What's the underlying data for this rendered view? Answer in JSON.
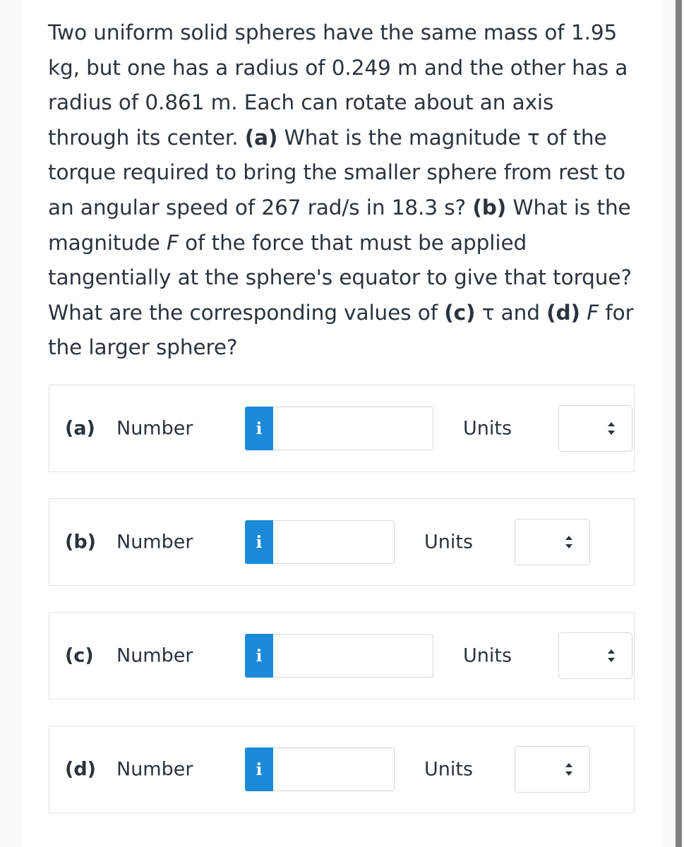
{
  "problem": {
    "segments": [
      {
        "text": "Two uniform solid spheres have the same mass of 1.95 kg, but one has a radius of 0.249 m and the other has a radius of 0.861 m. Each can rotate about an axis through its center. ",
        "style": "normal"
      },
      {
        "text": "(a)",
        "style": "bold"
      },
      {
        "text": " What is the magnitude ",
        "style": "normal"
      },
      {
        "text": "τ",
        "style": "symbol"
      },
      {
        "text": " of the torque required to bring the smaller sphere from rest to an angular speed of 267 rad/s in 18.3 s? ",
        "style": "normal"
      },
      {
        "text": "(b)",
        "style": "bold"
      },
      {
        "text": " What is the magnitude ",
        "style": "normal"
      },
      {
        "text": "F",
        "style": "italic"
      },
      {
        "text": " of the force that must be applied tangentially at the sphere's equator to give that torque? What are the corresponding values of ",
        "style": "normal"
      },
      {
        "text": "(c)",
        "style": "bold"
      },
      {
        "text": " ",
        "style": "normal"
      },
      {
        "text": "τ",
        "style": "symbol"
      },
      {
        "text": " and ",
        "style": "normal"
      },
      {
        "text": "(d)",
        "style": "bold"
      },
      {
        "text": " ",
        "style": "normal"
      },
      {
        "text": "F",
        "style": "italic"
      },
      {
        "text": " for the larger sphere?",
        "style": "normal"
      }
    ],
    "full_text": "Two uniform solid spheres have the same mass of 1.95 kg, but one has a radius of 0.249 m and the other has a radius of 0.861 m. Each can rotate about an axis through its center. (a) What is the magnitude τ of the torque required to bring the smaller sphere from rest to an angular speed of 267 rad/s in 18.3 s? (b) What is the magnitude F of the force that must be applied tangentially at the sphere's equator to give that torque? What are the corresponding values of (c) τ and (d) F for the larger sphere?",
    "values": {
      "mass": "1.95 kg",
      "radius_small": "0.249 m",
      "radius_large": "0.861 m",
      "angular_speed": "267 rad/s",
      "time": "18.3 s"
    }
  },
  "answers": {
    "rows": [
      {
        "part": "(a)",
        "number_label": "Number",
        "info_icon": "info-icon",
        "info_glyph": "i",
        "number_value": "",
        "number_placeholder": "",
        "units_label": "Units",
        "units_value": "",
        "units_options": []
      },
      {
        "part": "(b)",
        "number_label": "Number",
        "info_icon": "info-icon",
        "info_glyph": "i",
        "number_value": "",
        "number_placeholder": "",
        "units_label": "Units",
        "units_value": "",
        "units_options": []
      },
      {
        "part": "(c)",
        "number_label": "Number",
        "info_icon": "info-icon",
        "info_glyph": "i",
        "number_value": "",
        "number_placeholder": "",
        "units_label": "Units",
        "units_value": "",
        "units_options": []
      },
      {
        "part": "(d)",
        "number_label": "Number",
        "info_icon": "info-icon",
        "info_glyph": "i",
        "number_value": "",
        "number_placeholder": "",
        "units_label": "Units",
        "units_value": "",
        "units_options": []
      }
    ]
  },
  "colors": {
    "accent_blue": "#1b8ad8",
    "text": "#2a333e",
    "border": "#e2e2e2",
    "input_border": "#d8d8d8",
    "page_bg": "#fafafa",
    "sheet_bg": "#ffffff",
    "scrollbar_thumb": "#808080"
  },
  "scrollbar": {
    "name": "vertical-scrollbar",
    "thumb_position": "full"
  }
}
